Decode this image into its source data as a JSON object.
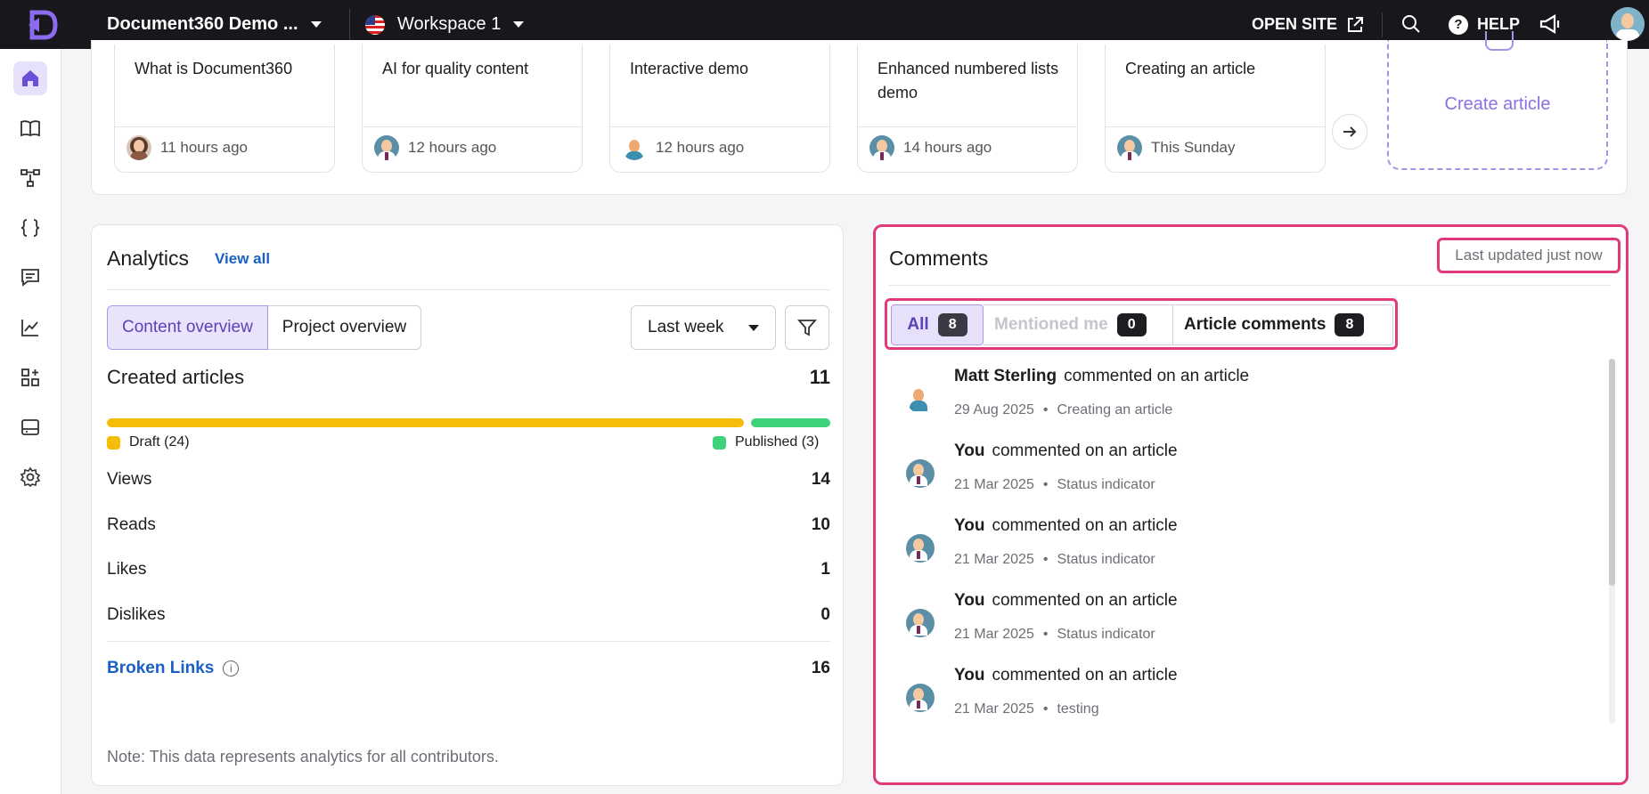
{
  "header": {
    "project": "Document360 Demo ...",
    "workspace": "Workspace 1",
    "open_site": "OPEN SITE",
    "help": "HELP"
  },
  "sidebar": {
    "items": [
      "home-icon",
      "book-icon",
      "hierarchy-icon",
      "api-braces-icon",
      "chat-icon",
      "analytics-icon",
      "apps-icon",
      "widget-icon",
      "settings-icon"
    ]
  },
  "recent_articles": [
    {
      "title": "What is Document360",
      "time": "11 hours ago"
    },
    {
      "title": "AI for quality content",
      "time": "12 hours ago"
    },
    {
      "title": "Interactive demo",
      "time": "12 hours ago"
    },
    {
      "title": "Enhanced numbered lists demo",
      "time": "14 hours ago"
    },
    {
      "title": "Creating an article",
      "time": "This Sunday"
    }
  ],
  "create_article": "Create article",
  "analytics": {
    "title": "Analytics",
    "view_all": "View all",
    "tabs": [
      "Content overview",
      "Project overview"
    ],
    "period": "Last week",
    "created_label": "Created articles",
    "created_value": "11",
    "draft_label": "Draft (24)",
    "published_label": "Published (3)",
    "draft_count": 24,
    "published_count": 3,
    "rows": [
      {
        "label": "Views",
        "value": "14"
      },
      {
        "label": "Reads",
        "value": "10"
      },
      {
        "label": "Likes",
        "value": "1"
      },
      {
        "label": "Dislikes",
        "value": "0"
      }
    ],
    "broken_label": "Broken Links",
    "broken_value": "16",
    "note": "Note: This data represents analytics for all contributors."
  },
  "comments": {
    "title": "Comments",
    "last_updated": "Last updated just now",
    "tabs": [
      {
        "label": "All",
        "count": "8"
      },
      {
        "label": "Mentioned me",
        "count": "0"
      },
      {
        "label": "Article comments",
        "count": "8"
      }
    ],
    "items": [
      {
        "user": "Matt Sterling",
        "action": "commented on an article",
        "date": "29 Aug 2025",
        "article": "Creating an article"
      },
      {
        "user": "You",
        "action": "commented on an article",
        "date": "21 Mar 2025",
        "article": "Status indicator"
      },
      {
        "user": "You",
        "action": "commented on an article",
        "date": "21 Mar 2025",
        "article": "Status indicator"
      },
      {
        "user": "You",
        "action": "commented on an article",
        "date": "21 Mar 2025",
        "article": "Status indicator"
      },
      {
        "user": "You",
        "action": "commented on an article",
        "date": "21 Mar 2025",
        "article": "testing"
      }
    ]
  }
}
